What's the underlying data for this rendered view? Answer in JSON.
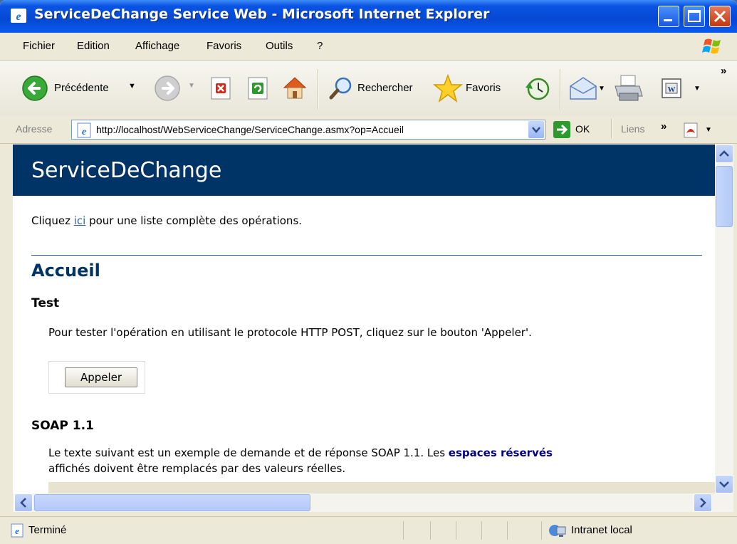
{
  "window": {
    "title": "ServiceDeChange Service Web - Microsoft Internet Explorer"
  },
  "menu": {
    "items": [
      "Fichier",
      "Edition",
      "Affichage",
      "Favoris",
      "Outils",
      "?"
    ]
  },
  "toolbar": {
    "back_label": "Précédente",
    "search_label": "Rechercher",
    "favorites_label": "Favoris",
    "more": "»"
  },
  "address": {
    "label": "Adresse",
    "url": "http://localhost/WebServiceChange/ServiceChange.asmx?op=Accueil",
    "go_label": "OK",
    "links_label": "Liens",
    "links_more": "»"
  },
  "page": {
    "banner_title": "ServiceDeChange",
    "intro_prefix": "Cliquez ",
    "intro_link": "ici",
    "intro_suffix": " pour une liste complète des opérations.",
    "operation_title": "Accueil",
    "test_heading": "Test",
    "test_text": "Pour tester l'opération en utilisant le protocole HTTP POST, cliquez sur le bouton 'Appeler'.",
    "invoke_button": "Appeler",
    "soap_heading": "SOAP 1.1",
    "soap_text_1": "Le texte suivant est un exemple de demande et de réponse SOAP 1.1. Les ",
    "soap_placeholder_link": "espaces réservés",
    "soap_text_2": "affichés doivent être remplacés par des valeurs réelles."
  },
  "status": {
    "text": "Terminé",
    "zone": "Intranet local"
  },
  "colors": {
    "banner": "#003366",
    "heading": "#003366",
    "link": "#336699",
    "titlebar": "#0548d4"
  }
}
